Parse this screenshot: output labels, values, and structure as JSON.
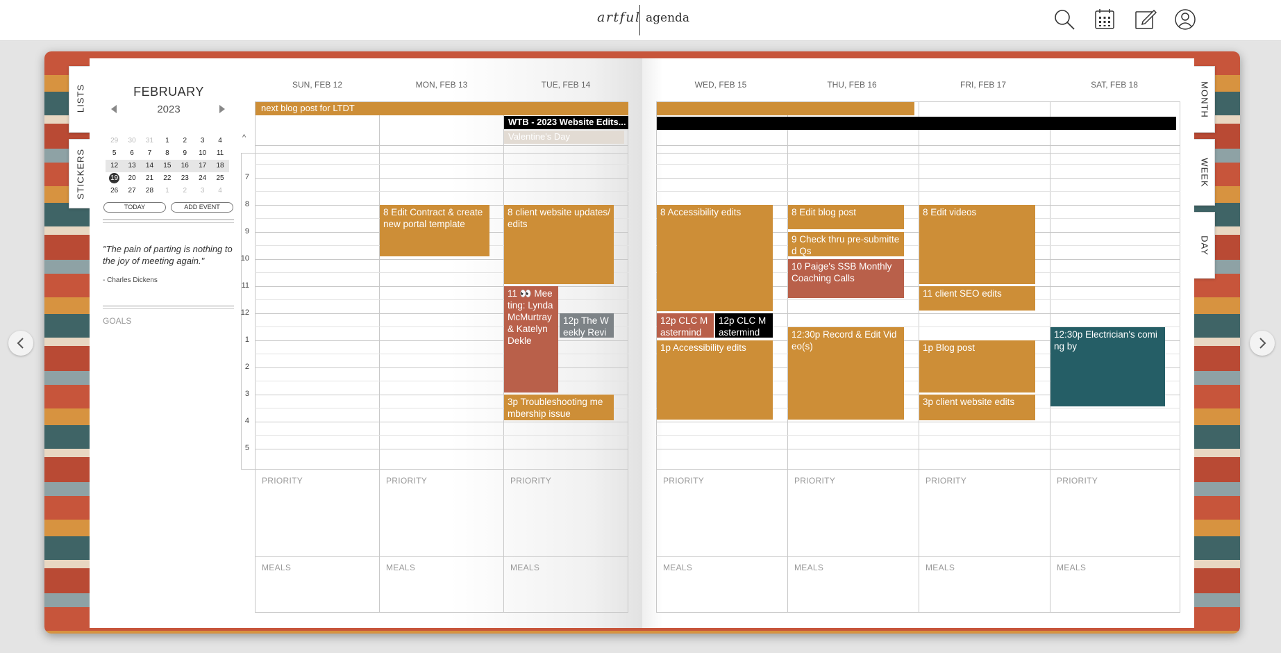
{
  "app": {
    "logo_left": "artful",
    "logo_right": "agenda"
  },
  "toolbar": {
    "icons": [
      "search-icon",
      "calendar-grid-icon",
      "edit-icon",
      "user-icon"
    ]
  },
  "tabs": {
    "left": [
      "LISTS",
      "STICKERS"
    ],
    "right": [
      "MONTH",
      "WEEK",
      "DAY"
    ]
  },
  "mini_calendar": {
    "month": "FEBRUARY",
    "year": "2023",
    "weeks": [
      [
        "29",
        "30",
        "31",
        "1",
        "2",
        "3",
        "4"
      ],
      [
        "5",
        "6",
        "7",
        "8",
        "9",
        "10",
        "11"
      ],
      [
        "12",
        "13",
        "14",
        "15",
        "16",
        "17",
        "18"
      ],
      [
        "19",
        "20",
        "21",
        "22",
        "23",
        "24",
        "25"
      ],
      [
        "26",
        "27",
        "28",
        "1",
        "2",
        "3",
        "4"
      ]
    ],
    "today_button": "TODAY",
    "add_event_button": "ADD EVENT"
  },
  "quote": {
    "text": "\"The pain of parting is nothing to the joy of meeting again.\"",
    "author": "- Charles Dickens"
  },
  "goals_label": "GOALS",
  "days": [
    "SUN, FEB 12",
    "MON, FEB 13",
    "TUE, FEB 14",
    "WED, FEB 15",
    "THU, FEB 16",
    "FRI, FEB 17",
    "SAT, FEB 18"
  ],
  "hours": [
    "7",
    "8",
    "9",
    "10",
    "11",
    "12",
    "1",
    "2",
    "3",
    "4",
    "5"
  ],
  "collapse_icon": "^",
  "priority_label": "PRIORITY",
  "meals_label": "MEALS",
  "allday": {
    "left_bar": "next blog post for LTDT",
    "wtb": "WTB - 2023 Website Edits...",
    "valentines": "Valentine's Day"
  },
  "events": {
    "mon_contract": "8 Edit Contract & create new portal template",
    "tue_client": "8 client website updates/edits",
    "tue_meeting": "11 👀 Meeting: Lynda McMurtray & Katelyn Dekle",
    "tue_weekly": "12p The Weekly Revi",
    "tue_troubleshoot": "3p Troubleshooting membership issue",
    "wed_access": "8 Accessibility edits",
    "wed_clc1": "12p CLC Mastermind",
    "wed_clc2": "12p CLC Mastermind",
    "wed_access2": "1p Accessibility edits",
    "thu_blog": "8 Edit blog post",
    "thu_check": "9 Check thru pre-submitted Qs",
    "thu_paige": "10 Paige's SSB Monthly Coaching Calls",
    "thu_record": "12:30p Record & Edit Video(s)",
    "fri_videos": "8 Edit videos",
    "fri_seo": "11 client SEO edits",
    "fri_blog": "1p Blog post",
    "fri_website": "3p client website edits",
    "sat_electrician": "12:30p Electrician's coming by"
  },
  "colors": {
    "ochre": "#cd8e37",
    "rust": "#b9604a",
    "black": "#000000",
    "grey": "#7d8387",
    "teal": "#255e66"
  }
}
